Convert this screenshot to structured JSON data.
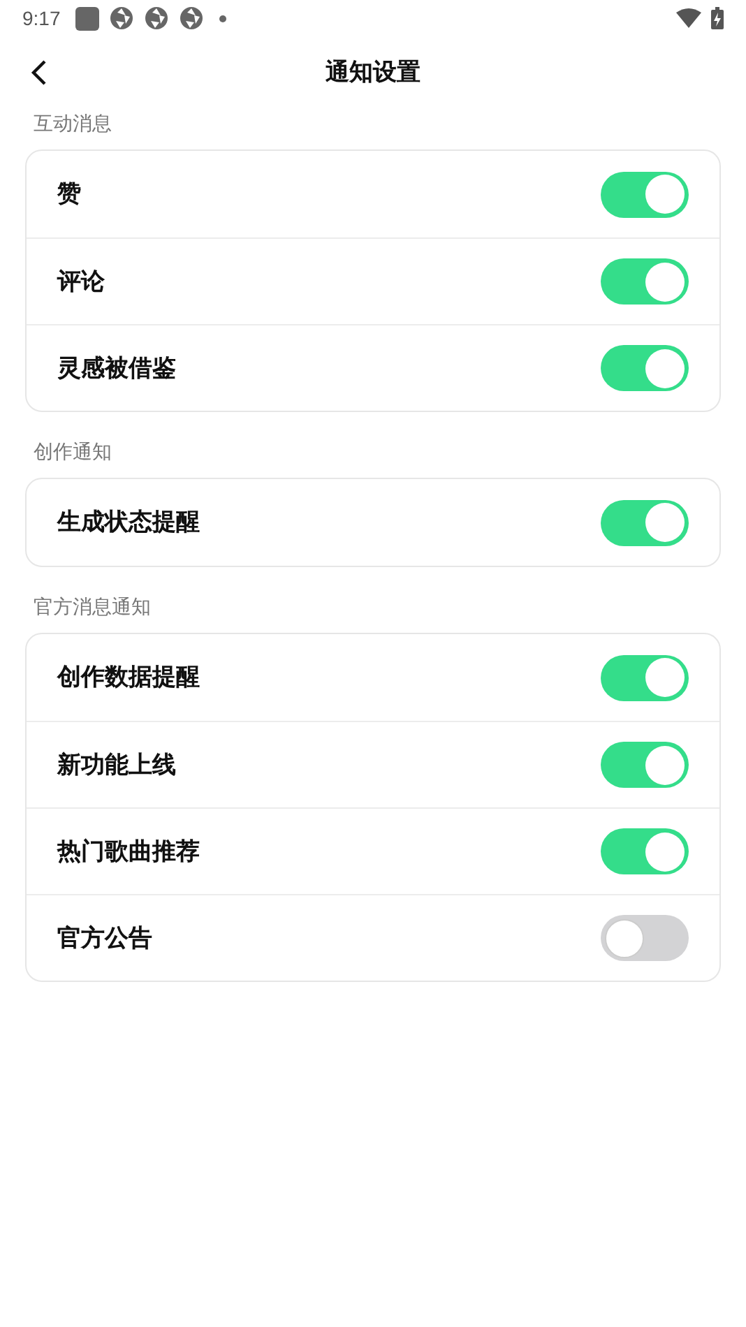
{
  "status_bar": {
    "time": "9:17"
  },
  "header": {
    "title": "通知设置"
  },
  "sections": [
    {
      "title": "互动消息",
      "items": [
        {
          "label": "赞",
          "on": true
        },
        {
          "label": "评论",
          "on": true
        },
        {
          "label": "灵感被借鉴",
          "on": true
        }
      ]
    },
    {
      "title": "创作通知",
      "items": [
        {
          "label": "生成状态提醒",
          "on": true
        }
      ]
    },
    {
      "title": "官方消息通知",
      "items": [
        {
          "label": "创作数据提醒",
          "on": true
        },
        {
          "label": "新功能上线",
          "on": true
        },
        {
          "label": "热门歌曲推荐",
          "on": true
        },
        {
          "label": "官方公告",
          "on": false
        }
      ]
    }
  ]
}
